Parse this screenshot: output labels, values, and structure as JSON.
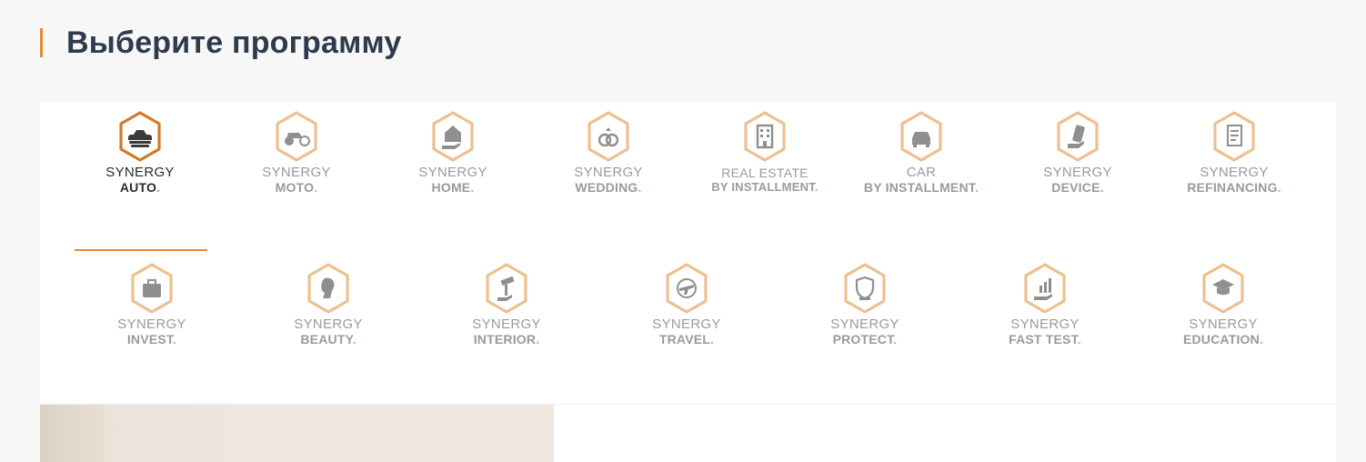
{
  "page": {
    "title": "Выберите программу"
  },
  "colors": {
    "accent": "#e8893a",
    "hex_inactive": "#ecc08f",
    "icon_inactive": "#8f8f8f",
    "text_inactive": "#9a9a9a",
    "text_active": "#2b2b2b"
  },
  "programs": [
    {
      "line1": "SYNERGY",
      "line2": "AUTO",
      "dot": ".",
      "icon": "car-hands-icon",
      "active": true
    },
    {
      "line1": "SYNERGY",
      "line2": "MOTO",
      "dot": ".",
      "icon": "motorcycle-icon"
    },
    {
      "line1": "SYNERGY",
      "line2": "HOME",
      "dot": ".",
      "icon": "house-hand-icon"
    },
    {
      "line1": "SYNERGY",
      "line2": "WEDDING",
      "dot": ".",
      "icon": "rings-icon"
    },
    {
      "line1": "REAL ESTATE",
      "line2": "BY INSTALLMENT",
      "dot": ".",
      "icon": "building-icon"
    },
    {
      "line1": "CAR",
      "line2": "BY INSTALLMENT",
      "dot": ".",
      "icon": "car-front-icon"
    },
    {
      "line1": "SYNERGY",
      "line2": "DEVICE",
      "dot": ".",
      "icon": "phone-hand-icon"
    },
    {
      "line1": "SYNERGY",
      "line2": "REFINANCING",
      "dot": ".",
      "icon": "document-icon"
    },
    {
      "line1": "SYNERGY",
      "line2": "INVEST",
      "dot": ".",
      "icon": "briefcase-icon"
    },
    {
      "line1": "SYNERGY",
      "line2": "BEAUTY",
      "dot": ".",
      "icon": "woman-profile-icon"
    },
    {
      "line1": "SYNERGY",
      "line2": "INTERIOR",
      "dot": ".",
      "icon": "paint-roller-icon"
    },
    {
      "line1": "SYNERGY",
      "line2": "TRAVEL",
      "dot": ".",
      "icon": "airplane-icon"
    },
    {
      "line1": "SYNERGY",
      "line2": "PROTECT",
      "dot": ".",
      "icon": "shield-icon"
    },
    {
      "line1": "SYNERGY",
      "line2": "FAST TEST",
      "dot": ".",
      "icon": "bar-chart-hand-icon"
    },
    {
      "line1": "SYNERGY",
      "line2": "EDUCATION",
      "dot": ".",
      "icon": "graduation-cap-icon"
    }
  ]
}
